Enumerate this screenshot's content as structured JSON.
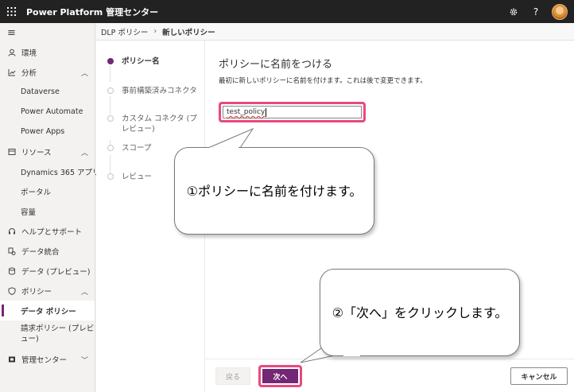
{
  "app": {
    "title": "Power Platform 管理センター"
  },
  "topbar": {
    "icons": [
      "waffle-icon",
      "gear-icon",
      "help-icon",
      "avatar"
    ],
    "help_glyph": "?"
  },
  "sidebar": {
    "items": [
      {
        "label": "環境",
        "icon": "environment-icon",
        "level": 0
      },
      {
        "label": "分析",
        "icon": "analytics-icon",
        "level": 0,
        "expanded": true
      },
      {
        "label": "Dataverse",
        "level": 1
      },
      {
        "label": "Power Automate",
        "level": 1
      },
      {
        "label": "Power Apps",
        "level": 1
      },
      {
        "label": "リソース",
        "icon": "resources-icon",
        "level": 0,
        "expanded": true
      },
      {
        "label": "Dynamics 365 アプリ",
        "level": 1
      },
      {
        "label": "ポータル",
        "level": 1
      },
      {
        "label": "容量",
        "level": 1
      },
      {
        "label": "ヘルプとサポート",
        "icon": "headset-icon",
        "level": 0
      },
      {
        "label": "データ統合",
        "icon": "data-integration-icon",
        "level": 0
      },
      {
        "label": "データ (プレビュー)",
        "icon": "data-icon",
        "level": 0
      },
      {
        "label": "ポリシー",
        "icon": "shield-icon",
        "level": 0,
        "expanded": true
      },
      {
        "label": "データ ポリシー",
        "level": 1,
        "active": true
      },
      {
        "label": "請求ポリシー (プレビュー)",
        "level": 1
      },
      {
        "label": "管理センター",
        "icon": "admin-centers-icon",
        "level": 0,
        "expanded": false
      }
    ]
  },
  "breadcrumb": {
    "parent": "DLP ポリシー",
    "current": "新しいポリシー"
  },
  "wizard": {
    "steps": [
      {
        "label": "ポリシー名",
        "current": true
      },
      {
        "label": "事前構築済みコネクタ",
        "current": false
      },
      {
        "label": "カスタム コネクタ (プレビュー)",
        "current": false
      },
      {
        "label": "スコープ",
        "current": false
      },
      {
        "label": "レビュー",
        "current": false
      }
    ]
  },
  "content": {
    "heading": "ポリシーに名前をつける",
    "description": "最初に新しいポリシーに名前を付けます。これは後で変更できます。",
    "name_input_value": "test_policy"
  },
  "footer": {
    "back_label": "戻る",
    "next_label": "次へ",
    "cancel_label": "キャンセル"
  },
  "callouts": {
    "callout1": "①ポリシーに名前を付けます。",
    "callout2": "②「次へ」をクリックします。"
  },
  "colors": {
    "accent": "#742774",
    "highlight": "#e8497e",
    "topbar": "#222222"
  }
}
